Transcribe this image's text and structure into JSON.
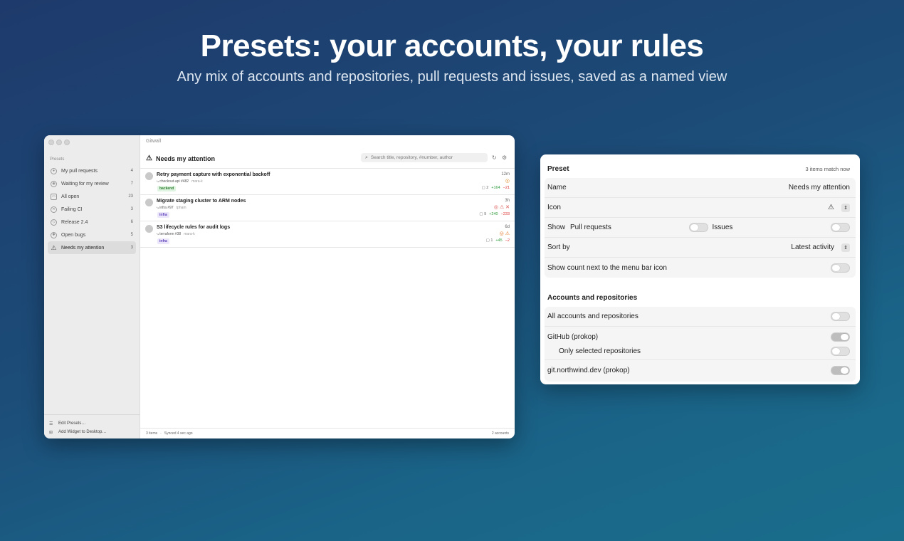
{
  "hero": {
    "title": "Presets: your accounts, your rules",
    "subtitle": "Any mix of accounts and repositories, pull requests and issues, saved as a named view"
  },
  "window": {
    "app_title": "Gitwall",
    "sidebar": {
      "heading": "Presets",
      "items": [
        {
          "label": "My pull requests",
          "count": "4",
          "icon": "person-icon"
        },
        {
          "label": "Waiting for my review",
          "count": "7",
          "icon": "eye-icon"
        },
        {
          "label": "All open",
          "count": "23",
          "icon": "tray-icon"
        },
        {
          "label": "Failing CI",
          "count": "3",
          "icon": "x-circle-icon"
        },
        {
          "label": "Release 2.4",
          "count": "6",
          "icon": "tag-icon"
        },
        {
          "label": "Open bugs",
          "count": "5",
          "icon": "bug-icon"
        },
        {
          "label": "Needs my attention",
          "count": "3",
          "icon": "warning-icon"
        }
      ],
      "footer": {
        "edit_presets": "Edit Presets…",
        "add_widget": "Add Widget to Desktop…"
      }
    },
    "header": {
      "title": "Needs my attention",
      "search_placeholder": "Search title, repository, #number, author"
    },
    "rows": [
      {
        "title": "Retry payment capture with exponential backoff",
        "repo": "checkout-api #482",
        "author": "mara-k",
        "tag": "backend",
        "time": "12m",
        "status": "◎",
        "comments": "2",
        "additions": "+164",
        "deletions": "−21"
      },
      {
        "title": "Migrate staging cluster to ARM nodes",
        "repo": "infra #97",
        "author": "tpham",
        "tag": "infra",
        "time": "3h",
        "status": "◎ ⚠ ✕",
        "comments": "9",
        "additions": "+240",
        "deletions": "−233"
      },
      {
        "title": "S3 lifecycle rules for audit logs",
        "repo": "terraform #38",
        "author": "mara-k",
        "tag": "infra",
        "time": "6d",
        "status": "◎ ⚠",
        "comments": "1",
        "additions": "+45",
        "deletions": "−2"
      }
    ],
    "statusbar": {
      "items": "3 items",
      "synced": "Synced 4 sec ago",
      "accounts": "2 accounts"
    }
  },
  "panel": {
    "heading": "Preset",
    "match": "3 items match now",
    "name_label": "Name",
    "name_value": "Needs my attention",
    "icon_label": "Icon",
    "show_label": "Show",
    "pull_requests_label": "Pull requests",
    "pull_requests_on": false,
    "issues_label": "Issues",
    "issues_on": false,
    "sort_label": "Sort by",
    "sort_value": "Latest activity",
    "count_label": "Show count next to the menu bar icon",
    "count_on": false,
    "section_title": "Accounts and repositories",
    "all_accounts_label": "All accounts and repositories",
    "all_accounts_on": false,
    "github_label": "GitHub (prokop)",
    "github_on": true,
    "only_selected_label": "Only selected repositories",
    "only_selected_on": false,
    "gitnorthwind_label": "git.northwind.dev (prokop)",
    "gitnorthwind_on": true
  }
}
